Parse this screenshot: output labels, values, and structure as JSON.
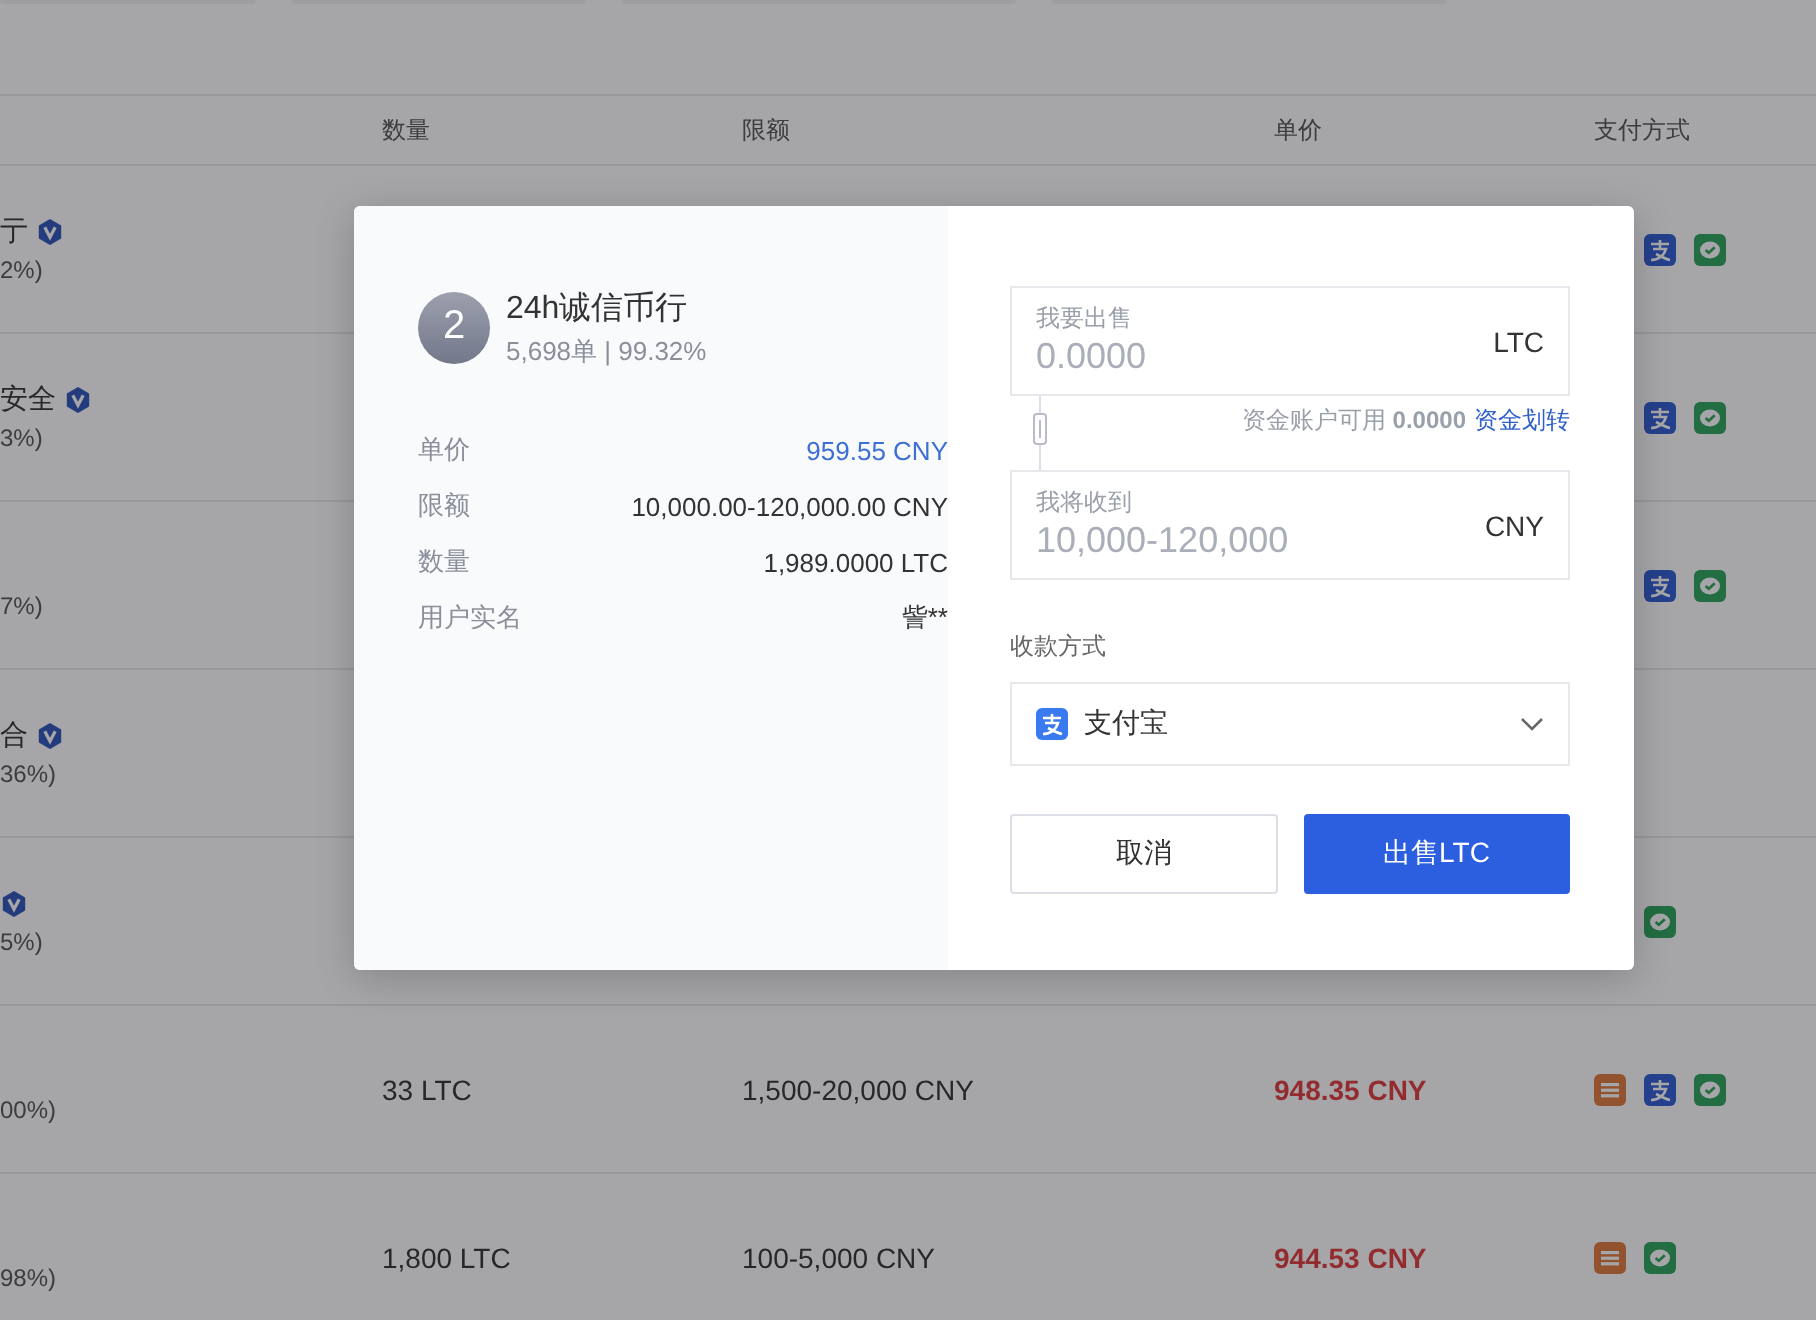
{
  "table": {
    "columns": [
      "数量",
      "限额",
      "单价",
      "支付方式"
    ],
    "rows": [
      {
        "name": "亍",
        "verified": true,
        "stats": "2%)",
        "payments": [
          {
            "kind": "alipay"
          },
          {
            "kind": "wechat"
          }
        ]
      },
      {
        "name": "安全",
        "verified": true,
        "stats": "3%)",
        "payments": [
          {
            "kind": "alipay"
          },
          {
            "kind": "wechat"
          }
        ]
      },
      {
        "stats": "7%)",
        "verified": false,
        "payments": [
          {
            "kind": "alipay"
          },
          {
            "kind": "wechat"
          }
        ]
      },
      {
        "name": "合",
        "verified": true,
        "stats": "36%)"
      },
      {
        "verified": true,
        "stats": "5%)",
        "payments": [
          {
            "kind": "wechat"
          }
        ]
      },
      {
        "verified": false,
        "stats": "00%)",
        "quantity": "33 LTC",
        "limit": "1,500-20,000 CNY",
        "price": "948.35 CNY",
        "payments": [
          {
            "kind": "bank"
          },
          {
            "kind": "alipay"
          },
          {
            "kind": "wechat"
          }
        ]
      },
      {
        "verified": false,
        "stats": "98%)",
        "quantity": "1,800 LTC",
        "limit": "100-5,000 CNY",
        "price": "944.53 CNY",
        "payments": [
          {
            "kind": "bank"
          },
          {
            "kind": "wechat"
          }
        ]
      }
    ]
  },
  "dialog": {
    "merchant": {
      "rank": "2",
      "name": "24h诚信币行",
      "stats": "5,698单 | 99.32%"
    },
    "details": [
      {
        "label": "单价",
        "value": "959.55 CNY",
        "highlight": true
      },
      {
        "label": "限额",
        "value": "10,000.00-120,000.00 CNY",
        "highlight": false
      },
      {
        "label": "数量",
        "value": "1,989.0000 LTC",
        "highlight": false
      },
      {
        "label": "用户实名",
        "value": "訾**",
        "highlight": false
      }
    ],
    "sell_field": {
      "label": "我要出售",
      "placeholder": "0.0000",
      "unit": "LTC"
    },
    "balance": {
      "text": "资金账户可用",
      "amount": "0.0000",
      "link": "资金划转"
    },
    "receive_field": {
      "label": "我将收到",
      "placeholder": "10,000-120,000",
      "unit": "CNY"
    },
    "payment_label": "收款方式",
    "payment_select": {
      "kind": "alipay",
      "value": "支付宝"
    },
    "buttons": [
      {
        "label": "取消",
        "kind": "secondary"
      },
      {
        "label": "出售LTC",
        "kind": "primary"
      }
    ]
  }
}
